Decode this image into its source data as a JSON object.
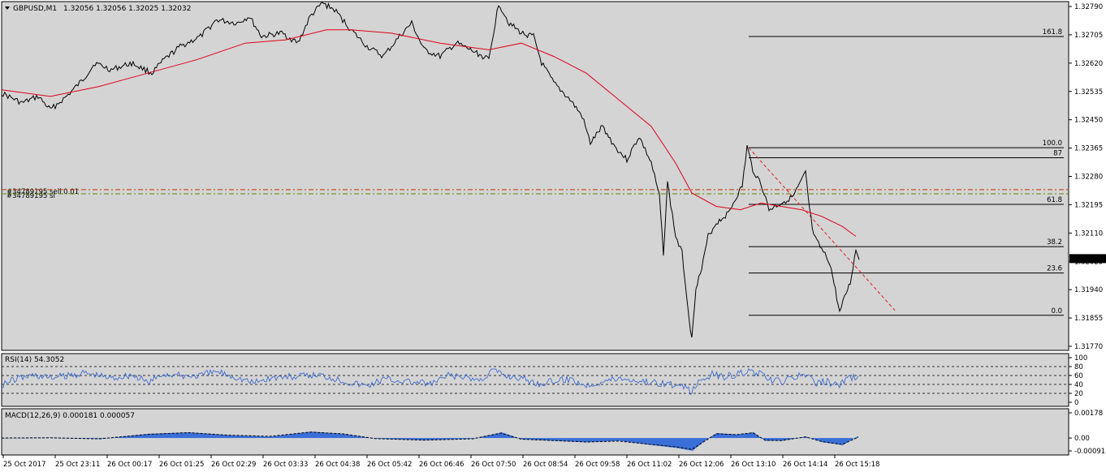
{
  "symbol_header": {
    "symbol": "GBPUSD,M1",
    "ohlc": "1.32056 1.32056 1.32025 1.32032"
  },
  "colors": {
    "background": "#d4d4d4",
    "price_line": "#000000",
    "moving_average": "#e0001b",
    "rsi_line": "#3060d0",
    "macd_histogram": "#3a6fd8",
    "macd_signal": "#000000",
    "order_line_green": "#5a8a00",
    "order_line_red": "#c83200",
    "fib_line": "#000000",
    "trend_line": "#e02020",
    "current_price_tag": "#000000"
  },
  "order_labels": {
    "line1": "#34789195 sell 0.01",
    "line2": "#34789195 sl"
  },
  "current_price": "1.32032",
  "chart_data": [
    {
      "type": "line",
      "name": "main",
      "title": "GBPUSD,M1",
      "yaxis_ticks": [
        "1.32790",
        "1.32705",
        "1.32620",
        "1.32535",
        "1.32450",
        "1.32365",
        "1.32280",
        "1.32195",
        "1.32110",
        "1.32025",
        "1.31940",
        "1.31855",
        "1.31770"
      ],
      "ylim": [
        1.3177,
        1.3279
      ],
      "x_ticks": [
        "25 Oct 2017",
        "25 Oct 23:11",
        "26 Oct 00:17",
        "26 Oct 01:25",
        "26 Oct 02:29",
        "26 Oct 03:33",
        "26 Oct 04:38",
        "26 Oct 05:42",
        "26 Oct 06:46",
        "26 Oct 07:50",
        "26 Oct 08:54",
        "26 Oct 09:58",
        "26 Oct 11:02",
        "26 Oct 12:06",
        "26 Oct 13:10",
        "26 Oct 14:14",
        "26 Oct 15:18"
      ],
      "price_points": [
        [
          0,
          1.3253
        ],
        [
          25,
          1.325
        ],
        [
          45,
          1.3252
        ],
        [
          60,
          1.3248
        ],
        [
          80,
          1.3252
        ],
        [
          100,
          1.3257
        ],
        [
          115,
          1.3262
        ],
        [
          135,
          1.326
        ],
        [
          160,
          1.3262
        ],
        [
          185,
          1.3259
        ],
        [
          200,
          1.3263
        ],
        [
          220,
          1.3267
        ],
        [
          245,
          1.327
        ],
        [
          265,
          1.3275
        ],
        [
          290,
          1.3274
        ],
        [
          305,
          1.3276
        ],
        [
          320,
          1.327
        ],
        [
          345,
          1.3271
        ],
        [
          365,
          1.3268
        ],
        [
          380,
          1.3276
        ],
        [
          395,
          1.328
        ],
        [
          410,
          1.3278
        ],
        [
          430,
          1.3272
        ],
        [
          450,
          1.3267
        ],
        [
          470,
          1.3264
        ],
        [
          490,
          1.327
        ],
        [
          505,
          1.3274
        ],
        [
          520,
          1.3266
        ],
        [
          540,
          1.3264
        ],
        [
          560,
          1.3268
        ],
        [
          585,
          1.3265
        ],
        [
          600,
          1.3263
        ],
        [
          612,
          1.328
        ],
        [
          625,
          1.3274
        ],
        [
          640,
          1.3271
        ],
        [
          655,
          1.327
        ],
        [
          665,
          1.3262
        ],
        [
          680,
          1.3256
        ],
        [
          700,
          1.3251
        ],
        [
          715,
          1.3246
        ],
        [
          725,
          1.3238
        ],
        [
          740,
          1.3243
        ],
        [
          755,
          1.3237
        ],
        [
          770,
          1.3233
        ],
        [
          785,
          1.324
        ],
        [
          800,
          1.3232
        ],
        [
          810,
          1.3222
        ],
        [
          815,
          1.3205
        ],
        [
          820,
          1.3226
        ],
        [
          830,
          1.321
        ],
        [
          838,
          1.3205
        ],
        [
          845,
          1.3189
        ],
        [
          850,
          1.3179
        ],
        [
          855,
          1.3195
        ],
        [
          862,
          1.32
        ],
        [
          870,
          1.321
        ],
        [
          880,
          1.3214
        ],
        [
          895,
          1.3217
        ],
        [
          905,
          1.3222
        ],
        [
          912,
          1.3225
        ],
        [
          918,
          1.3237
        ],
        [
          925,
          1.323
        ],
        [
          935,
          1.3226
        ],
        [
          945,
          1.3218
        ],
        [
          960,
          1.322
        ],
        [
          975,
          1.3222
        ],
        [
          990,
          1.3229
        ],
        [
          995,
          1.3218
        ],
        [
          1000,
          1.321
        ],
        [
          1010,
          1.3206
        ],
        [
          1020,
          1.3202
        ],
        [
          1025,
          1.3196
        ],
        [
          1032,
          1.3187
        ],
        [
          1040,
          1.3193
        ],
        [
          1045,
          1.3196
        ],
        [
          1052,
          1.3206
        ],
        [
          1056,
          1.3203
        ]
      ],
      "moving_average_points": [
        [
          0,
          1.3254
        ],
        [
          60,
          1.3252
        ],
        [
          120,
          1.3255
        ],
        [
          180,
          1.3259
        ],
        [
          240,
          1.3263
        ],
        [
          300,
          1.3268
        ],
        [
          350,
          1.3269
        ],
        [
          400,
          1.3272
        ],
        [
          430,
          1.3272
        ],
        [
          480,
          1.3271
        ],
        [
          540,
          1.3268
        ],
        [
          600,
          1.3266
        ],
        [
          640,
          1.3268
        ],
        [
          680,
          1.3264
        ],
        [
          720,
          1.3259
        ],
        [
          760,
          1.3251
        ],
        [
          800,
          1.3243
        ],
        [
          830,
          1.3232
        ],
        [
          850,
          1.3223
        ],
        [
          880,
          1.3219
        ],
        [
          910,
          1.3218
        ],
        [
          935,
          1.322
        ],
        [
          960,
          1.3219
        ],
        [
          985,
          1.3218
        ],
        [
          1010,
          1.3216
        ],
        [
          1035,
          1.3213
        ],
        [
          1052,
          1.321
        ]
      ],
      "order_lines": [
        1.3224,
        1.32235
      ],
      "fibonacci": {
        "x_range": [
          922,
          1310
        ],
        "levels": [
          {
            "label": "161.8",
            "price": 1.327
          },
          {
            "label": "100.0",
            "price": 1.32366
          },
          {
            "label": "87",
            "price": 1.32336
          },
          {
            "label": "61.8",
            "price": 1.32196
          },
          {
            "label": "38.2",
            "price": 1.32069
          },
          {
            "label": "23.6",
            "price": 1.3199
          },
          {
            "label": "0.0",
            "price": 1.31863
          }
        ]
      },
      "trend_line": [
        [
          922,
          1.32366
        ],
        [
          1102,
          1.31878
        ]
      ]
    },
    {
      "type": "line",
      "name": "rsi",
      "title": "RSI(14) 54.3052",
      "yaxis_ticks": [
        "100",
        "80",
        "60",
        "40",
        "20",
        "0"
      ],
      "ylim": [
        0,
        100
      ],
      "levels": [
        80,
        60,
        40,
        20
      ],
      "points": [
        [
          0,
          40
        ],
        [
          20,
          54
        ],
        [
          40,
          61
        ],
        [
          60,
          55
        ],
        [
          80,
          59
        ],
        [
          100,
          66
        ],
        [
          115,
          62
        ],
        [
          135,
          54
        ],
        [
          160,
          62
        ],
        [
          180,
          44
        ],
        [
          200,
          64
        ],
        [
          220,
          59
        ],
        [
          245,
          60
        ],
        [
          265,
          69
        ],
        [
          290,
          56
        ],
        [
          310,
          44
        ],
        [
          330,
          54
        ],
        [
          350,
          57
        ],
        [
          370,
          58
        ],
        [
          390,
          62
        ],
        [
          410,
          54
        ],
        [
          430,
          44
        ],
        [
          450,
          37
        ],
        [
          470,
          52
        ],
        [
          490,
          49
        ],
        [
          510,
          44
        ],
        [
          530,
          41
        ],
        [
          550,
          60
        ],
        [
          570,
          55
        ],
        [
          590,
          50
        ],
        [
          605,
          73
        ],
        [
          620,
          60
        ],
        [
          640,
          55
        ],
        [
          660,
          42
        ],
        [
          680,
          47
        ],
        [
          700,
          52
        ],
        [
          720,
          38
        ],
        [
          740,
          47
        ],
        [
          760,
          54
        ],
        [
          780,
          50
        ],
        [
          800,
          45
        ],
        [
          820,
          42
        ],
        [
          840,
          32
        ],
        [
          850,
          24
        ],
        [
          860,
          48
        ],
        [
          875,
          63
        ],
        [
          890,
          57
        ],
        [
          905,
          62
        ],
        [
          918,
          70
        ],
        [
          935,
          62
        ],
        [
          945,
          49
        ],
        [
          960,
          46
        ],
        [
          980,
          58
        ],
        [
          992,
          63
        ],
        [
          1000,
          42
        ],
        [
          1015,
          47
        ],
        [
          1030,
          38
        ],
        [
          1045,
          54
        ],
        [
          1055,
          59
        ]
      ]
    },
    {
      "type": "bar",
      "name": "macd",
      "title": "MACD(12,26,9) 0.000181 0.000057",
      "yaxis_ticks": [
        "0.00178",
        "0.00",
        "-0.00091"
      ],
      "ylim": [
        -0.00091,
        0.00178
      ],
      "histogram_points": [
        [
          0,
          0
        ],
        [
          60,
          3e-05
        ],
        [
          120,
          -7e-05
        ],
        [
          180,
          0.0003
        ],
        [
          230,
          0.0004
        ],
        [
          280,
          0.0002
        ],
        [
          330,
          0.0001
        ],
        [
          380,
          0.00045
        ],
        [
          420,
          0.0003
        ],
        [
          460,
          -5e-05
        ],
        [
          520,
          -0.00016
        ],
        [
          580,
          -5e-05
        ],
        [
          615,
          0.0004
        ],
        [
          640,
          -0.0001
        ],
        [
          680,
          -0.0002
        ],
        [
          720,
          -0.0003
        ],
        [
          760,
          -0.0002
        ],
        [
          800,
          -0.0005
        ],
        [
          830,
          -0.0007
        ],
        [
          850,
          -0.0009
        ],
        [
          865,
          -0.0002
        ],
        [
          880,
          0.00035
        ],
        [
          905,
          0.00025
        ],
        [
          925,
          0.0004
        ],
        [
          940,
          -0.0002
        ],
        [
          960,
          -0.0002
        ],
        [
          990,
          0.0001
        ],
        [
          1010,
          -0.0003
        ],
        [
          1035,
          -0.0005
        ],
        [
          1055,
          0.00018
        ]
      ],
      "signal_points": [
        [
          0,
          0
        ],
        [
          60,
          2e-05
        ],
        [
          120,
          -6e-05
        ],
        [
          180,
          0.00026
        ],
        [
          230,
          0.00038
        ],
        [
          280,
          0.0002
        ],
        [
          330,
          0.00012
        ],
        [
          380,
          0.00042
        ],
        [
          420,
          0.0003
        ],
        [
          460,
          -4e-05
        ],
        [
          520,
          -0.00015
        ],
        [
          580,
          -6e-05
        ],
        [
          615,
          0.00035
        ],
        [
          640,
          -8e-05
        ],
        [
          680,
          -0.00018
        ],
        [
          720,
          -0.00028
        ],
        [
          760,
          -0.00022
        ],
        [
          800,
          -0.00045
        ],
        [
          830,
          -0.00062
        ],
        [
          850,
          -0.0008
        ],
        [
          865,
          -0.00025
        ],
        [
          880,
          0.0003
        ],
        [
          905,
          0.00024
        ],
        [
          925,
          0.00037
        ],
        [
          940,
          -0.00015
        ],
        [
          960,
          -0.00018
        ],
        [
          990,
          8e-05
        ],
        [
          1010,
          -0.00025
        ],
        [
          1035,
          -0.00045
        ],
        [
          1055,
          6e-05
        ]
      ]
    }
  ]
}
